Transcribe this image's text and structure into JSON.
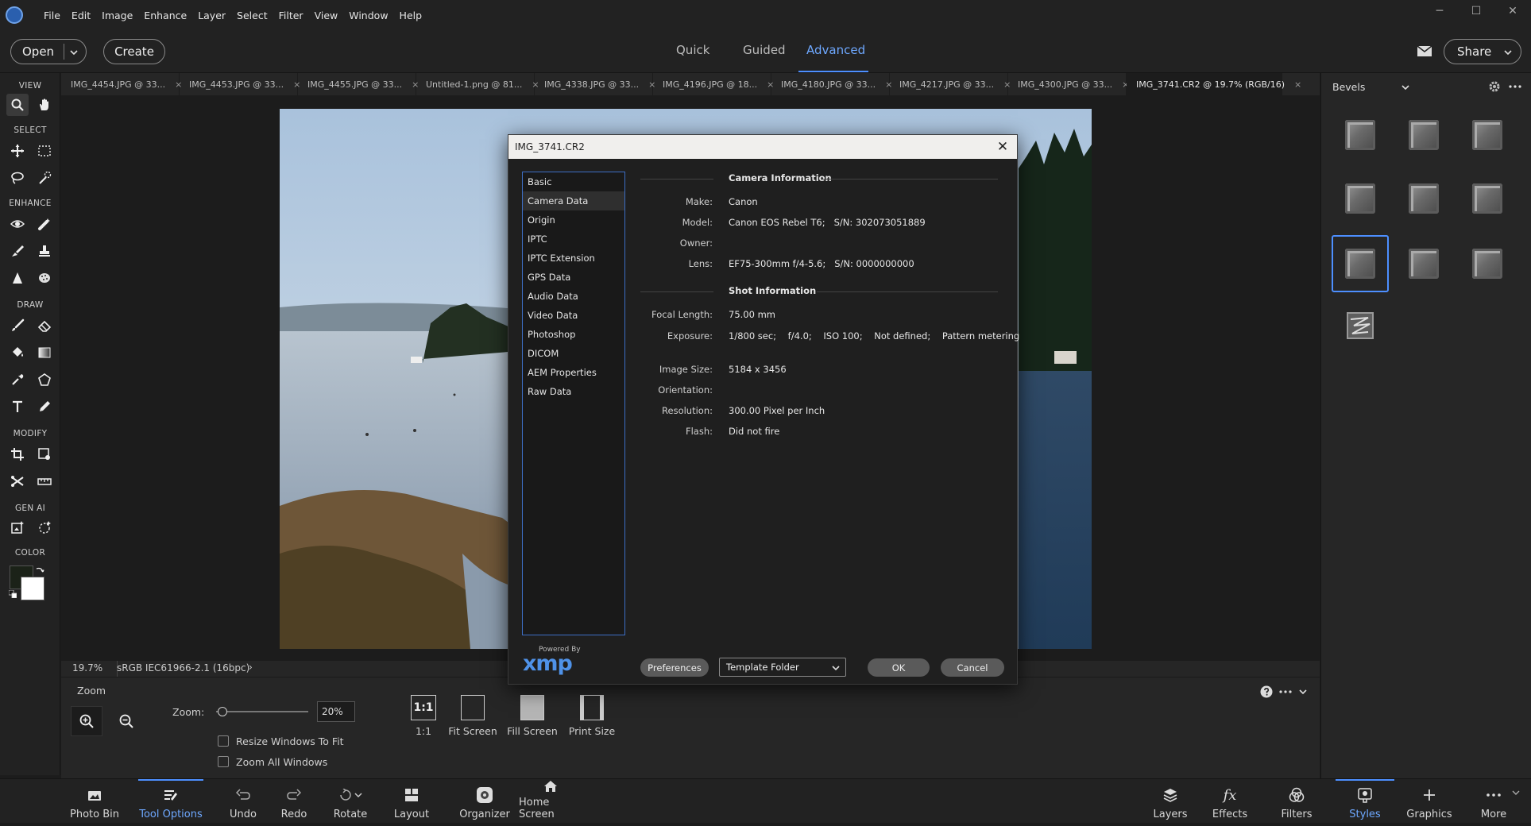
{
  "menu": {
    "items": [
      "File",
      "Edit",
      "Image",
      "Enhance",
      "Layer",
      "Select",
      "Filter",
      "View",
      "Window",
      "Help"
    ]
  },
  "modebar": {
    "open_label": "Open",
    "create_label": "Create",
    "share_label": "Share",
    "modes": [
      "Quick",
      "Guided",
      "Advanced"
    ],
    "active_mode": "Advanced"
  },
  "toolbar": {
    "sections": [
      "VIEW",
      "SELECT",
      "ENHANCE",
      "DRAW",
      "MODIFY",
      "GEN AI",
      "COLOR"
    ]
  },
  "doc_tabs": [
    {
      "label": "IMG_4454.JPG @ 33...",
      "active": false
    },
    {
      "label": "IMG_4453.JPG @ 33...",
      "active": false
    },
    {
      "label": "IMG_4455.JPG @ 33...",
      "active": false
    },
    {
      "label": "Untitled-1.png @ 81...",
      "active": false
    },
    {
      "label": "IMG_4338.JPG @ 33...",
      "active": false
    },
    {
      "label": "IMG_4196.JPG @ 18...",
      "active": false
    },
    {
      "label": "IMG_4180.JPG @ 33...",
      "active": false
    },
    {
      "label": "IMG_4217.JPG @ 33...",
      "active": false
    },
    {
      "label": "IMG_4300.JPG @ 33...",
      "active": false
    },
    {
      "label": "IMG_3741.CR2 @ 19.7% (RGB/16)",
      "active": true
    }
  ],
  "tab_close_glyph": "×",
  "status": {
    "zoom": "19.7%",
    "profile": "sRGB IEC61966-2.1 (16bpc)",
    "arrow": "›"
  },
  "tool_options": {
    "title": "Zoom",
    "zoom_label": "Zoom:",
    "zoom_value": "20%",
    "zoom_fraction": 0.02,
    "resize_windows": "Resize Windows To Fit",
    "zoom_all": "Zoom All Windows",
    "view_buttons": [
      "1:1",
      "Fit Screen",
      "Fill Screen",
      "Print Size"
    ],
    "one_to_one_icon": "1:1"
  },
  "taskbar": {
    "left": [
      "Photo Bin",
      "Tool Options",
      "Undo",
      "Redo",
      "Rotate",
      "Layout",
      "Organizer",
      "Home Screen"
    ],
    "right": [
      "Layers",
      "Effects",
      "Filters",
      "Styles",
      "Graphics",
      "More"
    ],
    "active_left": "Tool Options",
    "active_right": "Styles"
  },
  "right_panel": {
    "dropdown": "Bevels"
  },
  "dialog": {
    "title": "IMG_3741.CR2",
    "categories": [
      "Basic",
      "Camera Data",
      "Origin",
      "IPTC",
      "IPTC Extension",
      "GPS Data",
      "Audio Data",
      "Video Data",
      "Photoshop",
      "DICOM",
      "AEM Properties",
      "Raw Data"
    ],
    "selected_category": "Camera Data",
    "camera_section": "Camera Information",
    "camera_fields": [
      {
        "label": "Make:",
        "value": "Canon"
      },
      {
        "label": "Model:",
        "value": "Canon EOS Rebel T6;   S/N: 302073051889"
      },
      {
        "label": "Owner:",
        "value": ""
      },
      {
        "label": "Lens:",
        "value": "EF75-300mm f/4-5.6;   S/N: 0000000000"
      }
    ],
    "shot_section": "Shot Information",
    "shot_fields": [
      {
        "label": "Focal Length:",
        "value": "75.00 mm"
      },
      {
        "label": "Exposure:",
        "value": "1/800 sec;    f/4.0;    ISO 100;    Not defined;    Pattern metering"
      },
      {
        "label": "Image Size:",
        "value": "5184 x 3456"
      },
      {
        "label": "Orientation:",
        "value": ""
      },
      {
        "label": "Resolution:",
        "value": "300.00 Pixel per Inch"
      },
      {
        "label": "Flash:",
        "value": "Did not fire"
      }
    ],
    "powered_by": "Powered By",
    "xmp": "xmp",
    "preferences_label": "Preferences",
    "template_folder": "Template Folder",
    "ok_label": "OK",
    "cancel_label": "Cancel"
  }
}
